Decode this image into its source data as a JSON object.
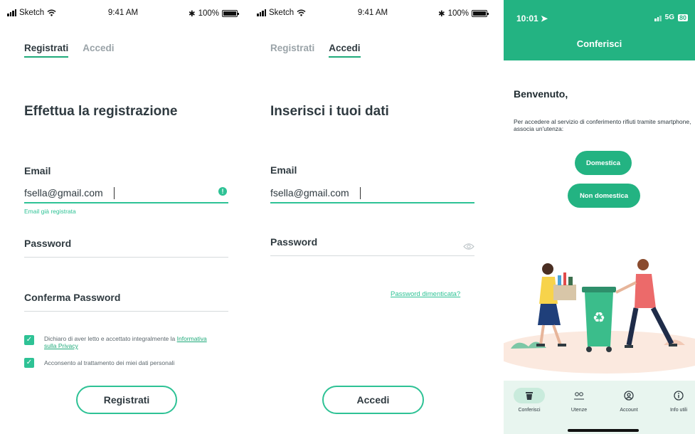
{
  "status": {
    "carrier": "Sketch",
    "time": "9:41 AM",
    "battery": "100%"
  },
  "register": {
    "tabs": [
      {
        "label": "Registrati",
        "active": true
      },
      {
        "label": "Accedi",
        "active": false
      }
    ],
    "heading": "Effettua la registrazione",
    "email_label": "Email",
    "email_value": "fsella@gmail.com",
    "email_error": "Email già registrata",
    "password_label": "Password",
    "confirm_label": "Conferma Password",
    "consent_privacy_text": "Dichiaro di aver letto e accettato integralmente la",
    "consent_privacy_link": "Informativa sulla Privacy",
    "consent_data_text": "Acconsento al trattamento dei miei dati personali",
    "submit_label": "Registrati"
  },
  "login": {
    "tabs": [
      {
        "label": "Registrati",
        "active": false
      },
      {
        "label": "Accedi",
        "active": true
      }
    ],
    "heading": "Inserisci i tuoi dati",
    "email_label": "Email",
    "email_value": "fsella@gmail.com",
    "password_label": "Password",
    "forgot_label": "Password dimenticata?",
    "submit_label": "Accedi"
  },
  "app": {
    "time": "10:01",
    "network": "5G",
    "battery": "80",
    "title": "Conferisci",
    "welcome": "Benvenuto,",
    "intro": "Per accedere al servizio di conferimento rifiuti tramite smartphone, associa un'utenza:",
    "btn_domestic": "Domestica",
    "btn_non_domestic": "Non domestica",
    "nav": [
      {
        "label": "Conferisci",
        "icon": "bin-icon",
        "active": true
      },
      {
        "label": "Utenze",
        "icon": "users-icon",
        "active": false
      },
      {
        "label": "Account",
        "icon": "account-icon",
        "active": false
      },
      {
        "label": "Info utili",
        "icon": "info-icon",
        "active": false
      }
    ]
  },
  "colors": {
    "accent": "#2ec295",
    "brand": "#23b382",
    "text": "#2f3a40"
  }
}
